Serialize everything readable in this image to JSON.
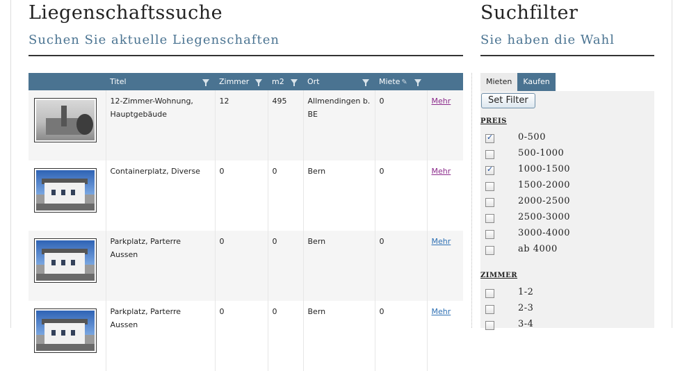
{
  "main": {
    "title": "Liegenschaftssuche",
    "subtitle": "Suchen Sie aktuelle Liegenschaften"
  },
  "table": {
    "columns": [
      "",
      "Titel",
      "Zimmer",
      "m2",
      "Ort",
      "Miete",
      ""
    ],
    "rows": [
      {
        "image": "old-village-photo",
        "titel": "12-Zimmer-Wohnung, Hauptgebäude",
        "zimmer": "12",
        "m2": "495",
        "ort": "Allmendingen b. BE",
        "miete": "0",
        "link": "Mehr",
        "visited": true
      },
      {
        "image": "modern-house-photo",
        "titel": "Containerplatz, Diverse",
        "zimmer": "0",
        "m2": "0",
        "ort": "Bern",
        "miete": "0",
        "link": "Mehr",
        "visited": true
      },
      {
        "image": "modern-house-photo",
        "titel": "Parkplatz, Parterre Aussen",
        "zimmer": "0",
        "m2": "0",
        "ort": "Bern",
        "miete": "0",
        "link": "Mehr",
        "visited": false
      },
      {
        "image": "modern-house-photo",
        "titel": "Parkplatz, Parterre Aussen",
        "zimmer": "0",
        "m2": "0",
        "ort": "Bern",
        "miete": "0",
        "link": "Mehr",
        "visited": false
      }
    ]
  },
  "side": {
    "title": "Suchfilter",
    "subtitle": "Sie haben die Wahl",
    "tabs": [
      "Mieten",
      "Kaufen"
    ],
    "set_filter": "Set Filter",
    "preis_label": "PREIS",
    "preis_options": [
      {
        "label": "0-500",
        "checked": true
      },
      {
        "label": "500-1000",
        "checked": false
      },
      {
        "label": "1000-1500",
        "checked": true
      },
      {
        "label": "1500-2000",
        "checked": false
      },
      {
        "label": "2000-2500",
        "checked": false
      },
      {
        "label": "2500-3000",
        "checked": false
      },
      {
        "label": "3000-4000",
        "checked": false
      },
      {
        "label": "ab 4000",
        "checked": false
      }
    ],
    "zimmer_label": "ZIMMER",
    "zimmer_options": [
      {
        "label": "1-2",
        "checked": false
      },
      {
        "label": "2-3",
        "checked": false
      },
      {
        "label": "3-4",
        "checked": false
      }
    ]
  },
  "colors": {
    "accent": "#4a7391",
    "visited_link": "#8b2a8b",
    "link": "#2d6fb3"
  }
}
